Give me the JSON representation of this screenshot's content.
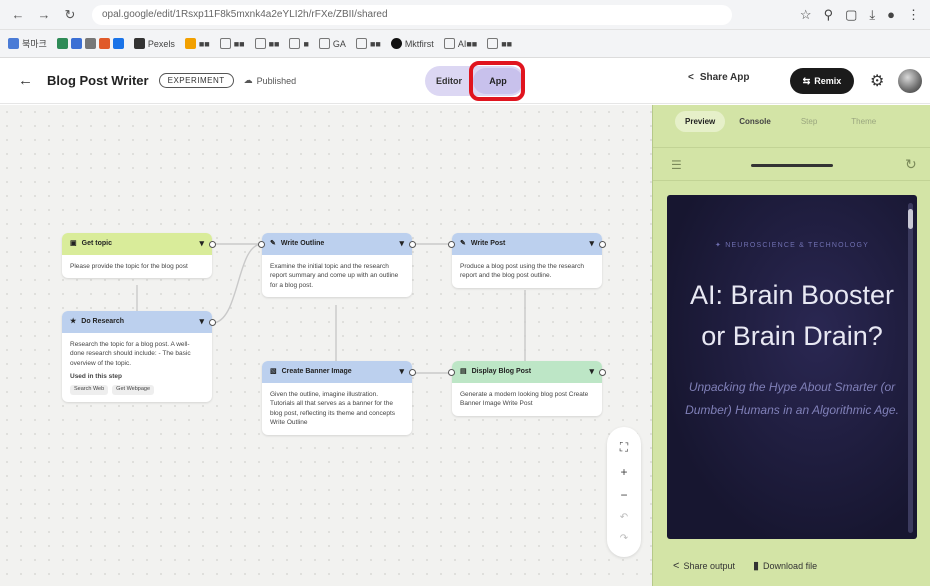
{
  "browser": {
    "url": "opal.google/edit/1Rsxp11F8k5mxnk4a2eYLI2h/rFXe/ZBII/shared",
    "bookmarks": [
      "북마크",
      "Pexels",
      "■■",
      "■■",
      "■■",
      "■",
      "GA",
      "■■",
      "Mktfirst",
      "AI■■",
      "■■"
    ]
  },
  "header": {
    "title": "Blog Post Writer",
    "badge": "EXPERIMENT",
    "status": "Published",
    "toggle_editor": "Editor",
    "toggle_app": "App",
    "share_app": "Share App",
    "remix": "Remix"
  },
  "nodes": {
    "get_topic": {
      "title": "Get topic",
      "body": "Please provide the topic for the blog post"
    },
    "research": {
      "title": "Do Research",
      "body": "Research the topic for a blog post. A well-done research should include: - The basic overview of the topic.",
      "used_label": "Used in this step",
      "tags": [
        "Search Web",
        "Get Webpage"
      ]
    },
    "outline": {
      "title": "Write Outline",
      "body": "Examine the initial topic and the research report summary and come up with an outline for a blog post."
    },
    "write_post": {
      "title": "Write Post",
      "body": "Produce a blog post using the the research report and the blog post outline."
    },
    "banner": {
      "title": "Create Banner Image",
      "body": "Given the outline, imagine illustration. Tutorials all that serves as a banner for the blog post, reflecting its theme and concepts Write Outline"
    },
    "display": {
      "title": "Display Blog Post",
      "body": "Generate a modern looking blog post Create Banner Image Write Post"
    }
  },
  "panel": {
    "tabs": [
      "Preview",
      "Console",
      "Step",
      "Theme"
    ],
    "preview": {
      "category": "NEUROSCIENCE & TECHNOLOGY",
      "title": "AI: Brain Booster or Brain Drain?",
      "subtitle": "Unpacking the Hype About Smarter (or Dumber) Humans in an Algorithmic Age."
    },
    "share_output": "Share output",
    "download_file": "Download file"
  },
  "colors": {
    "accent_toggle": "#dcd7f3",
    "highlight": "#e0141e",
    "panel": "#d3e4a6",
    "input_node": "#d9ec9a",
    "generate_node": "#bcd0ee",
    "output_node": "#bde6c6"
  }
}
